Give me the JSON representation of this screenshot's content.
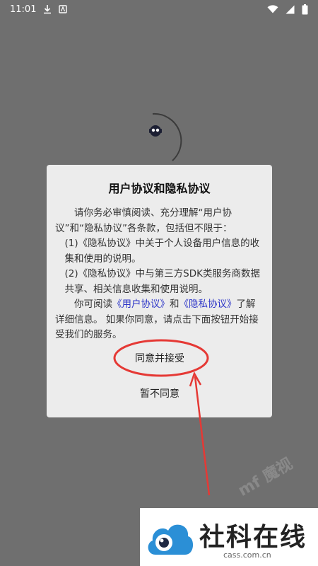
{
  "status_bar": {
    "time": "11:01"
  },
  "dialog": {
    "title": "用户协议和隐私协议",
    "p1": "请你务必审慎阅读、充分理解“用户协议”和“隐私协议”各条款，包括但不限于：",
    "p2": "(1)《隐私协议》中关于个人设备用户信息的收集和使用的说明。",
    "p3": "(2)《隐私协议》中与第三方SDK类服务商数据共享、相关信息收集和使用说明。",
    "p4_before": "你可阅读",
    "p4_link1": "《用户协议》",
    "p4_and": "和",
    "p4_link2": "《隐私协议》",
    "p4_after": "了解详细信息。 如果你同意，请点击下面按钮开始接受我们的服务。",
    "accept_label": "同意并接受",
    "decline_label": "暂不同意"
  },
  "watermark": {
    "title": "社科在线",
    "url": "cass.com.cn",
    "faint": "mf 魔视"
  },
  "colors": {
    "overlay": "#6f6f6f",
    "dialog_bg": "#ececec",
    "link": "#2c35c8",
    "annotation": "#e53935"
  }
}
